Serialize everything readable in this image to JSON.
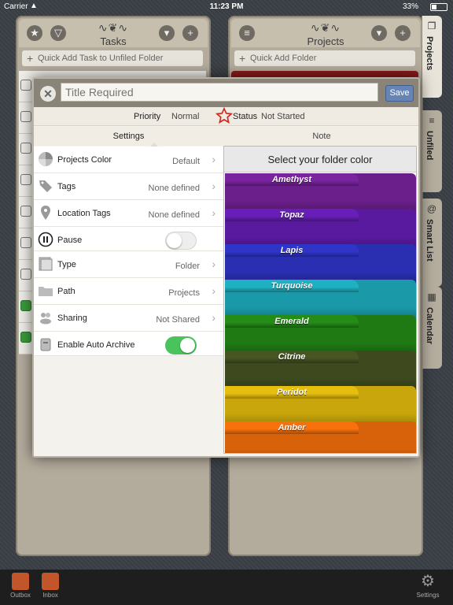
{
  "status_bar": {
    "carrier": "Carrier",
    "time": "11:23 PM",
    "battery": "33%"
  },
  "tasks_column": {
    "title": "Tasks",
    "quick_add": "Quick Add Task to Unfiled Folder"
  },
  "projects_column": {
    "title": "Projects",
    "quick_add": "Quick Add Folder"
  },
  "side_tabs": [
    "Projects",
    "Unfiled",
    "Smart List",
    "Calendar"
  ],
  "bottom_bar": {
    "outbox": "Outbox",
    "inbox": "Inbox",
    "settings": "Settings"
  },
  "editor": {
    "title_placeholder": "Title Required",
    "save_label": "Save",
    "priority_label": "Priority",
    "priority_value": "Normal",
    "status_label": "Status",
    "status_value": "Not Started",
    "tab_settings": "Settings",
    "tab_note": "Note"
  },
  "settings": [
    {
      "label": "Projects Color",
      "value": "Default",
      "icon": "color-wheel-icon"
    },
    {
      "label": "Tags",
      "value": "None defined",
      "icon": "tag-icon"
    },
    {
      "label": "Location Tags",
      "value": "None defined",
      "icon": "location-pin-icon"
    },
    {
      "label": "Pause",
      "toggle": false,
      "icon": "pause-icon"
    },
    {
      "label": "Type",
      "value": "Folder",
      "icon": "folder-type-icon"
    },
    {
      "label": "Path",
      "value": "Projects",
      "icon": "folder-icon"
    },
    {
      "label": "Sharing",
      "value": "Not Shared",
      "icon": "people-icon"
    },
    {
      "label": "Enable Auto Archive",
      "toggle": true,
      "icon": "archive-icon"
    }
  ],
  "folder_colors": {
    "header": "Select your folder color",
    "items": [
      {
        "name": "Amethyst",
        "color": "#6a1f8a"
      },
      {
        "name": "Topaz",
        "color": "#5a1aa0"
      },
      {
        "name": "Lapis",
        "color": "#2a2eb0"
      },
      {
        "name": "Turquoise",
        "color": "#1a9aa8"
      },
      {
        "name": "Emerald",
        "color": "#1f7a14"
      },
      {
        "name": "Citrine",
        "color": "#3e4a1e"
      },
      {
        "name": "Peridot",
        "color": "#c8a60c"
      },
      {
        "name": "Amber",
        "color": "#d8620a"
      }
    ]
  }
}
